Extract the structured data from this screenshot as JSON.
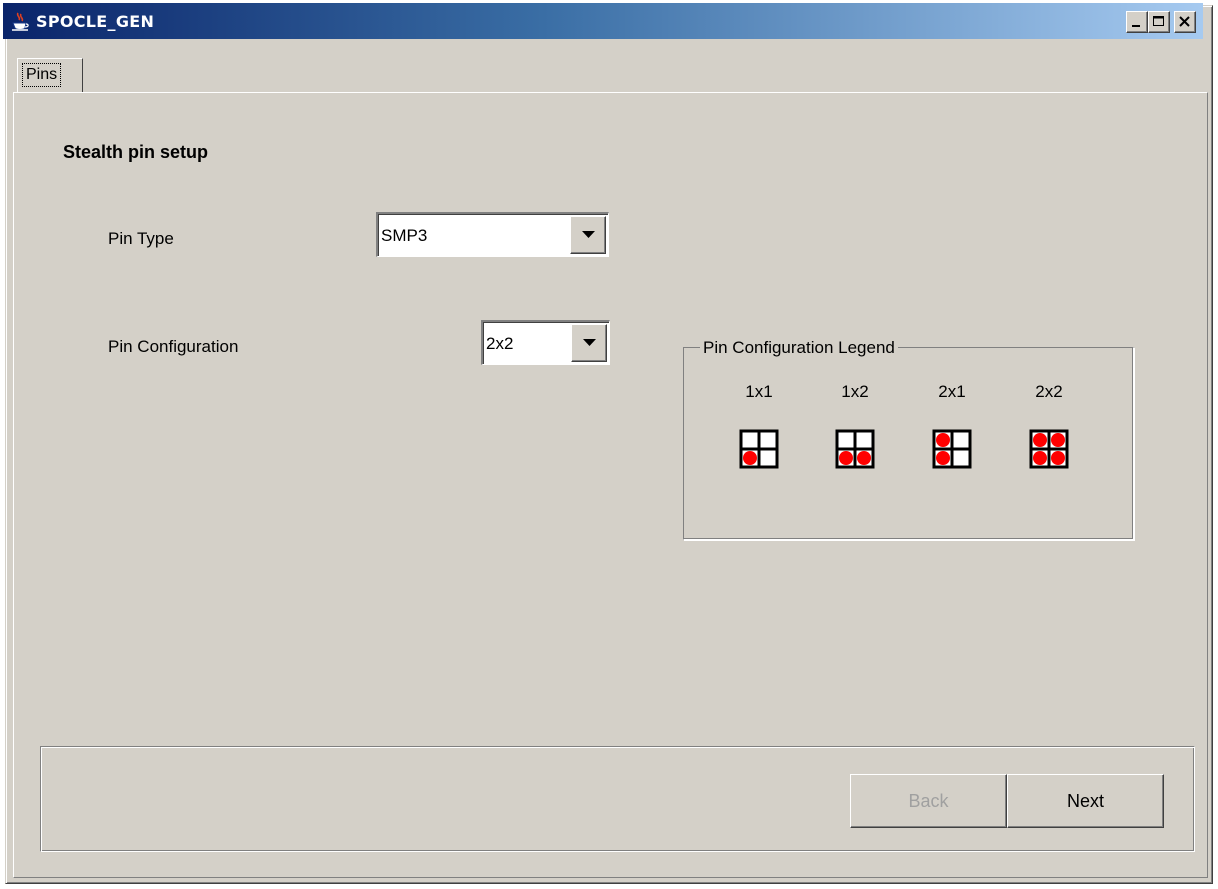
{
  "window": {
    "title": "SPOCLE_GEN",
    "icon": "java-cup-icon",
    "controls": [
      "minimize-icon",
      "maximize-icon",
      "close-icon"
    ]
  },
  "tabs": [
    {
      "label": "Pins",
      "selected": true
    }
  ],
  "section": {
    "title": "Stealth pin setup"
  },
  "form": {
    "pin_type": {
      "label": "Pin Type",
      "value": "SMP3"
    },
    "pin_configuration": {
      "label": "Pin Configuration",
      "value": "2x2"
    }
  },
  "legend": {
    "title": "Pin Configuration Legend",
    "pin_color": "#ff0000",
    "items": [
      {
        "label": "1x1",
        "pins": [
          false,
          false,
          true,
          false
        ]
      },
      {
        "label": "1x2",
        "pins": [
          false,
          false,
          true,
          true
        ]
      },
      {
        "label": "2x1",
        "pins": [
          true,
          false,
          true,
          false
        ]
      },
      {
        "label": "2x2",
        "pins": [
          true,
          true,
          true,
          true
        ]
      }
    ]
  },
  "buttons": {
    "back": {
      "label": "Back",
      "enabled": false
    },
    "next": {
      "label": "Next",
      "enabled": true
    }
  }
}
